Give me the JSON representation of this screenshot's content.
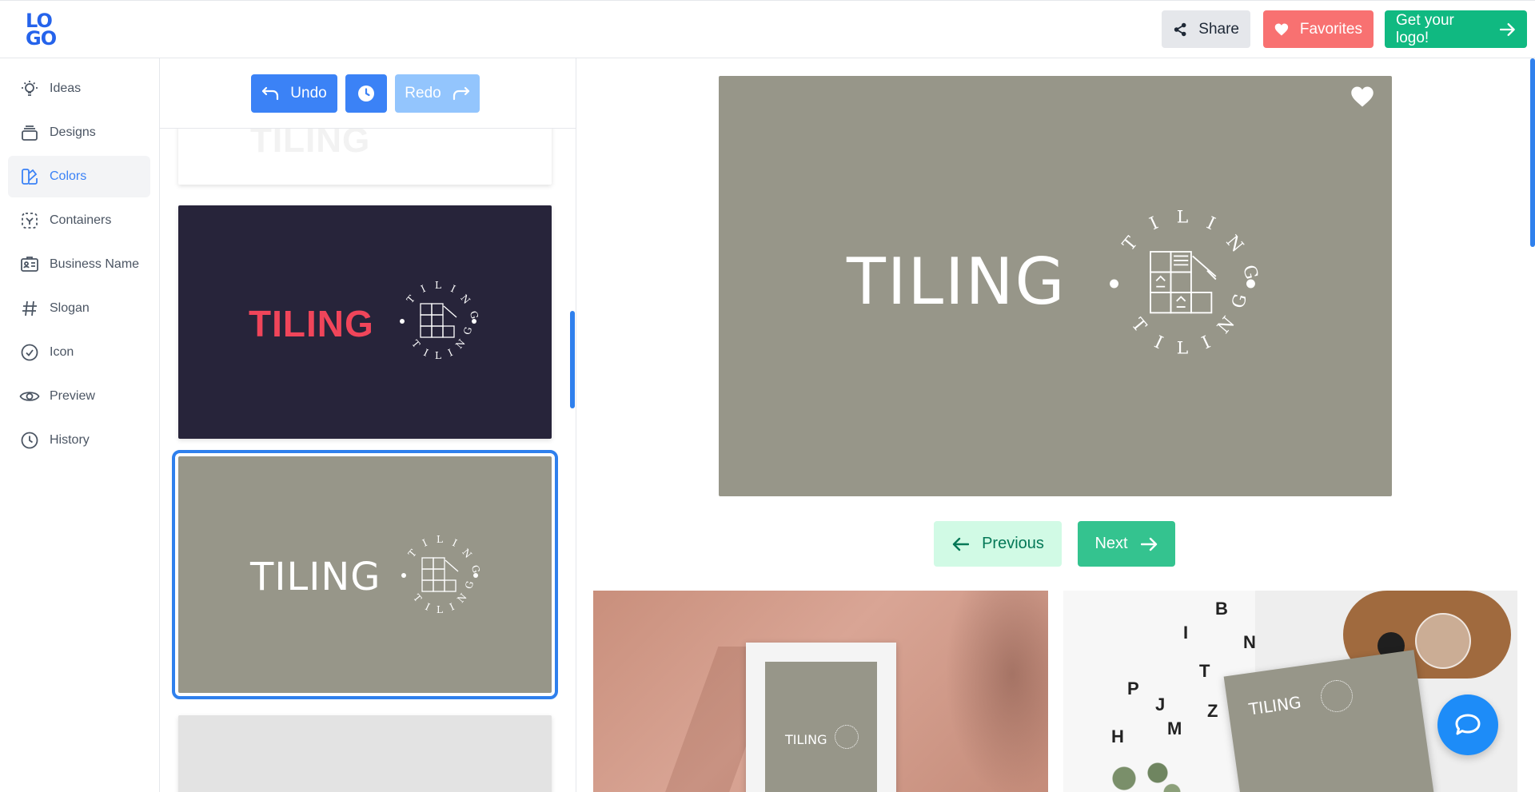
{
  "header": {
    "logo_top": "LO",
    "logo_bottom": "GO",
    "share_label": "Share",
    "favorites_label": "Favorites",
    "get_logo_label": "Get your logo!"
  },
  "sidebar": {
    "items": [
      {
        "label": "Ideas",
        "icon": "lightbulb-icon"
      },
      {
        "label": "Designs",
        "icon": "layers-icon"
      },
      {
        "label": "Colors",
        "icon": "swatch-icon"
      },
      {
        "label": "Containers",
        "icon": "container-icon"
      },
      {
        "label": "Business Name",
        "icon": "id-card-icon"
      },
      {
        "label": "Slogan",
        "icon": "hash-icon"
      },
      {
        "label": "Icon",
        "icon": "check-circle-icon"
      },
      {
        "label": "Preview",
        "icon": "eye-icon"
      },
      {
        "label": "History",
        "icon": "clock-icon"
      }
    ],
    "active": "Colors"
  },
  "toolbar": {
    "undo_label": "Undo",
    "redo_label": "Redo"
  },
  "variants": [
    {
      "word": "TILING",
      "background": "#ffffff"
    },
    {
      "word": "TILING",
      "background": "#27243a",
      "text_color": "#f0455a"
    },
    {
      "word": "TILING",
      "background": "#979689",
      "text_color": "#ffffff",
      "selected": true
    },
    {
      "word": "",
      "background": "#e3e3e3"
    }
  ],
  "preview": {
    "word": "TILING",
    "ring_text": "TILING",
    "background": "#979689"
  },
  "navigation": {
    "previous_label": "Previous",
    "next_label": "Next"
  },
  "mockups": [
    {
      "word": "TILING"
    },
    {
      "word": "TILING"
    }
  ],
  "colors": {
    "accent": "#3b82f6",
    "success": "#10b981",
    "favorite": "#f87171"
  }
}
